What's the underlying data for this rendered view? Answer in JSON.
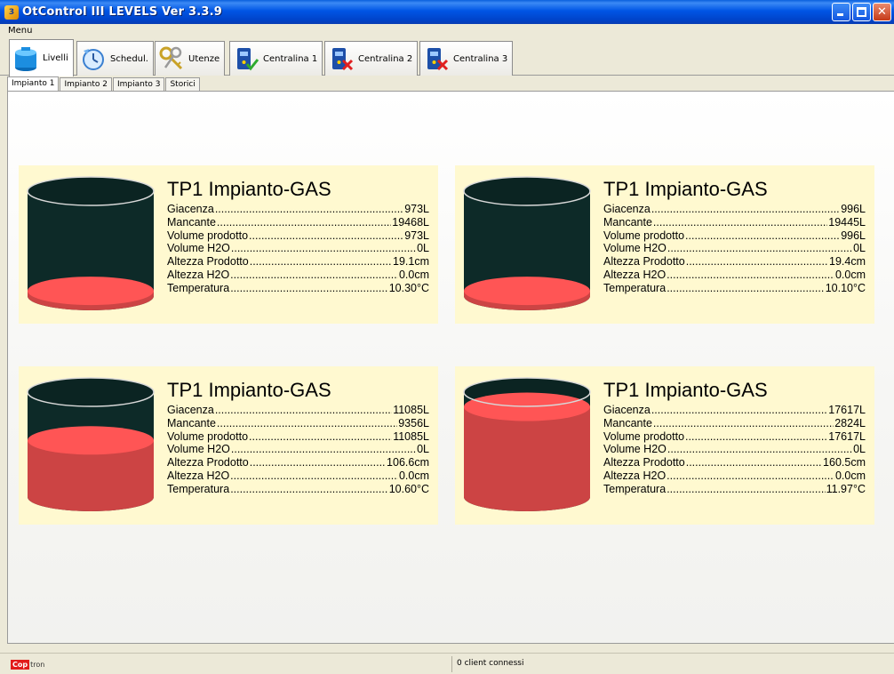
{
  "window": {
    "title": "OtControl III LEVELS Ver 3.3.9",
    "icon": "app-logo-icon"
  },
  "menu": {
    "label": "Menu"
  },
  "toolbar": {
    "tabs": [
      {
        "label": "Livelli",
        "icon": "tank-icon",
        "active": true
      },
      {
        "label": "Schedul.",
        "icon": "clock-icon",
        "active": false
      },
      {
        "label": "Utenze",
        "icon": "keys-icon",
        "active": false
      },
      {
        "label": "Centralina 1",
        "icon": "controller-connected-icon",
        "active": false
      },
      {
        "label": "Centralina 2",
        "icon": "controller-disconnected-icon",
        "active": false
      },
      {
        "label": "Centralina 3",
        "icon": "controller-disconnected-icon",
        "active": false
      }
    ]
  },
  "subtabs": [
    {
      "label": "Impianto 1",
      "active": true
    },
    {
      "label": "Impianto 2",
      "active": false
    },
    {
      "label": "Impianto 3",
      "active": false
    },
    {
      "label": "Storici",
      "active": false
    }
  ],
  "tanks": [
    {
      "title": "TP1 Impianto-GAS",
      "fill_fraction": 0.05,
      "colors": {
        "empty": "#0d2a28",
        "product": "#cc4444",
        "surface": "#ff5555"
      },
      "rows": [
        {
          "label": "Giacenza",
          "value": "973L"
        },
        {
          "label": "Mancante",
          "value": "19468L"
        },
        {
          "label": "Volume prodotto",
          "value": "973L"
        },
        {
          "label": "Volume H2O",
          "value": "0L"
        },
        {
          "label": "Altezza Prodotto",
          "value": "19.1cm"
        },
        {
          "label": "Altezza H2O",
          "value": "0.0cm"
        },
        {
          "label": "Temperatura",
          "value": "10.30°C"
        }
      ]
    },
    {
      "title": "TP1 Impianto-GAS",
      "fill_fraction": 0.05,
      "colors": {
        "empty": "#0d2a28",
        "product": "#cc4444",
        "surface": "#ff5555"
      },
      "rows": [
        {
          "label": "Giacenza",
          "value": "996L"
        },
        {
          "label": "Mancante",
          "value": "19445L"
        },
        {
          "label": "Volume prodotto",
          "value": "996L"
        },
        {
          "label": "Volume H2O",
          "value": "0L"
        },
        {
          "label": "Altezza Prodotto",
          "value": "19.4cm"
        },
        {
          "label": "Altezza H2O",
          "value": "0.0cm"
        },
        {
          "label": "Temperatura",
          "value": "10.10°C"
        }
      ]
    },
    {
      "title": "TP1 Impianto-GAS",
      "fill_fraction": 0.54,
      "colors": {
        "empty": "#0d2a28",
        "product": "#cc4444",
        "surface": "#ff5555"
      },
      "rows": [
        {
          "label": "Giacenza",
          "value": "11085L"
        },
        {
          "label": "Mancante",
          "value": "9356L"
        },
        {
          "label": "Volume prodotto",
          "value": "11085L"
        },
        {
          "label": "Volume H2O",
          "value": "0L"
        },
        {
          "label": "Altezza Prodotto",
          "value": "106.6cm"
        },
        {
          "label": "Altezza H2O",
          "value": "0.0cm"
        },
        {
          "label": "Temperatura",
          "value": "10.60°C"
        }
      ]
    },
    {
      "title": "TP1 Impianto-GAS",
      "fill_fraction": 0.86,
      "colors": {
        "empty": "#0d2a28",
        "product": "#cc4444",
        "surface": "#ff5555"
      },
      "rows": [
        {
          "label": "Giacenza",
          "value": "17617L"
        },
        {
          "label": "Mancante",
          "value": "2824L"
        },
        {
          "label": "Volume prodotto",
          "value": "17617L"
        },
        {
          "label": "Volume H2O",
          "value": "0L"
        },
        {
          "label": "Altezza Prodotto",
          "value": "160.5cm"
        },
        {
          "label": "Altezza H2O",
          "value": "0.0cm"
        },
        {
          "label": "Temperatura",
          "value": "11.97°C"
        }
      ]
    }
  ],
  "statusbar": {
    "logo_red": "Cop",
    "logo_rest": "tron",
    "status": "0 client connessi"
  }
}
